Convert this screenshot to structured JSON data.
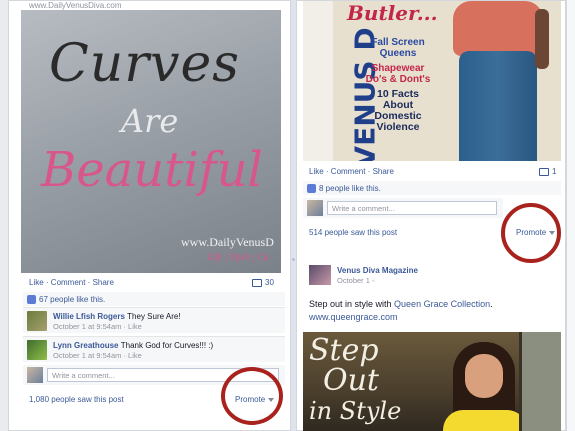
{
  "left_post": {
    "top_url": "www.DailyVenusDiva.com",
    "image": {
      "line1": "Curves",
      "line2": "Are",
      "line3": "Beautiful",
      "site": "www.DailyVenusD",
      "tagline": "Life | Style | Cu"
    },
    "actions": "Like · Comment · Share",
    "comment_count": "30",
    "likes_text": "67 people like this.",
    "comments": [
      {
        "name": "Willie Lfish Rogers",
        "text": "They Sure Are!",
        "meta": "October 1 at 9:54am · Like"
      },
      {
        "name": "Lynn Greathouse",
        "text": "Thank God for Curves!!! :)",
        "meta": "October 1 at 9:54am · Like"
      }
    ],
    "write_placeholder": "Write a comment...",
    "saw": "1,080 people saw this post",
    "promote": "Promote"
  },
  "right_post1": {
    "image": {
      "side_text": "VENUS D",
      "title": "Butler...",
      "head1": "Fall Screen",
      "head2": "Queens",
      "head3": "Shapewear",
      "head4": "Do's & Dont's",
      "head5": "10 Facts",
      "head6": "About",
      "head7": "Domestic",
      "head8": "Violence"
    },
    "actions": "Like · Comment · Share",
    "comment_count": "1",
    "likes_text": "8 people like this.",
    "write_placeholder": "Write a comment...",
    "saw": "514 people saw this post",
    "promote": "Promote"
  },
  "right_post2": {
    "page_name": "Venus Diva Magazine",
    "date": "October 1",
    "text_prefix": "Step out in style with ",
    "text_link": "Queen Grace Collection",
    "text_suffix": ".",
    "url": "www.queengrace.com",
    "image": {
      "line1": "Step",
      "line2": "Out",
      "line3": "in Style"
    }
  },
  "colors": {
    "link": "#3b5998",
    "highlight_circle": "#a8231d",
    "pink": "#d8578a"
  }
}
